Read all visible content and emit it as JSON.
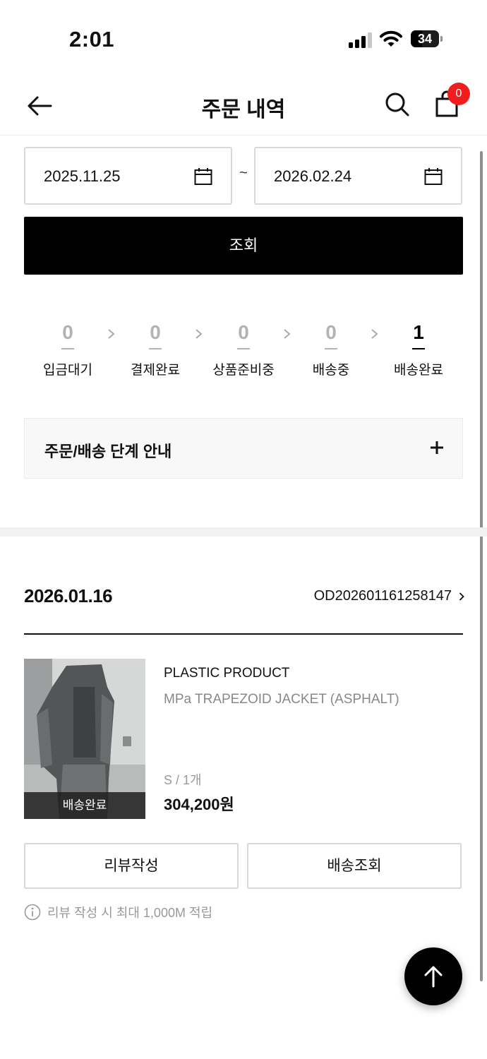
{
  "status_bar": {
    "time": "2:01",
    "battery": "34"
  },
  "header": {
    "title": "주문 내역",
    "cart_count": "0"
  },
  "filter": {
    "start_date": "2025.11.25",
    "separator": "~",
    "end_date": "2026.02.24",
    "search_label": "조회"
  },
  "steps": [
    {
      "count": "0",
      "label": "입금대기"
    },
    {
      "count": "0",
      "label": "결제완료"
    },
    {
      "count": "0",
      "label": "상품준비중"
    },
    {
      "count": "0",
      "label": "배송중"
    },
    {
      "count": "1",
      "label": "배송완료"
    }
  ],
  "guide": {
    "label": "주문/배송 단계 안내"
  },
  "order": {
    "date": "2026.01.16",
    "number": "OD202601161258147",
    "item": {
      "status": "배송완료",
      "brand": "PLASTIC PRODUCT",
      "name": "MPa TRAPEZOID JACKET (ASPHALT)",
      "option": "S / 1개",
      "price": "304,200원"
    },
    "review_label": "리뷰작성",
    "tracking_label": "배송조회",
    "notice": "리뷰 작성 시 최대 1,000M 적립"
  },
  "icons": {
    "back": "arrow-left-icon",
    "search": "search-icon",
    "cart": "shopping-bag-icon",
    "calendar": "calendar-icon",
    "step_arrow": "chevron-right-icon",
    "guide": "plus-icon",
    "notice": "info-icon",
    "top": "arrow-up-icon"
  },
  "colors": {
    "accent": "#000000",
    "badge": "#f01d1d",
    "muted": "#b3b3b3"
  }
}
